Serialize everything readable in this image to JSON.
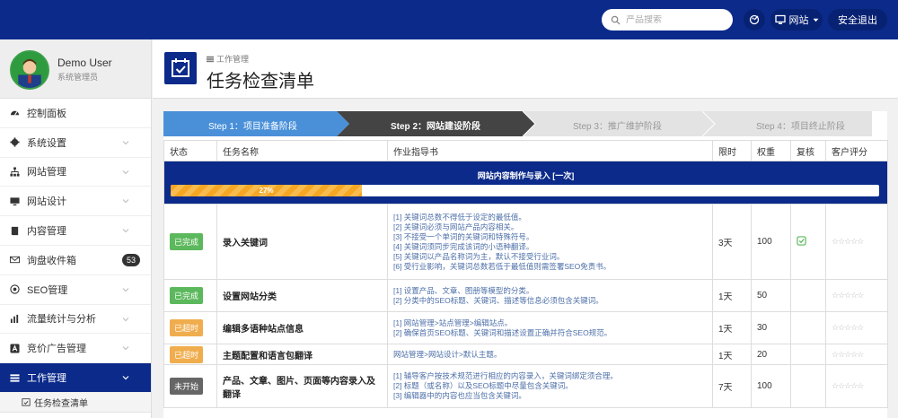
{
  "topbar": {
    "search_placeholder": "产品搜索",
    "website_label": "网站",
    "logout_label": "安全退出"
  },
  "user": {
    "name": "Demo User",
    "role": "系统管理员"
  },
  "sidebar": {
    "items": [
      {
        "label": "控制面板",
        "icon": "dashboard-icon"
      },
      {
        "label": "系统设置",
        "icon": "gear-icon"
      },
      {
        "label": "网站管理",
        "icon": "sitemap-icon"
      },
      {
        "label": "网站设计",
        "icon": "monitor-icon"
      },
      {
        "label": "内容管理",
        "icon": "book-icon"
      },
      {
        "label": "询盘收件箱",
        "icon": "envelope-icon",
        "badge": "53"
      },
      {
        "label": "SEO管理",
        "icon": "target-icon"
      },
      {
        "label": "流量统计与分析",
        "icon": "bar-chart-icon"
      },
      {
        "label": "竞价广告管理",
        "icon": "ad-icon"
      },
      {
        "label": "工作管理",
        "icon": "list-icon"
      }
    ],
    "submenu_label": "任务检查清单"
  },
  "header": {
    "breadcrumb": "工作管理",
    "title": "任务检查清单"
  },
  "steps": [
    {
      "label": "Step 1：项目准备阶段"
    },
    {
      "label": "Step 2：网站建设阶段"
    },
    {
      "label": "Step 3：推广维护阶段"
    },
    {
      "label": "Step 4：项目终止阶段"
    }
  ],
  "table": {
    "headers": [
      "状态",
      "任务名称",
      "作业指导书",
      "限时",
      "权重",
      "复核",
      "客户评分"
    ],
    "section_title": "网站内容制作与录入 [一次]",
    "progress": 27,
    "progress_label": "27%",
    "rows": [
      {
        "status": "已完成",
        "status_type": "done",
        "name": "录入关键词",
        "guide": [
          "[1] 关键词总数不得低于设定的最低值。",
          "[2] 关键词必须与网站产品内容相关。",
          "[3] 不接受一个单词的关键词和特殊符号。",
          "[4] 关键词须同步完成该词的小语种翻译。",
          "[5] 关键词以产品名称词为主，默认不接受行业词。",
          "[6] 受行业影响，关键词总数若低于最低值则需签署SEO免责书。"
        ],
        "time": "3天",
        "weight": "100",
        "checked": true,
        "rating": "☆☆☆☆☆"
      },
      {
        "status": "已完成",
        "status_type": "done",
        "name": "设置网站分类",
        "guide": [
          "[1] 设置产品、文章、图册等模型的分类。",
          "[2] 分类中的SEO标题、关键词、描述等信息必须包含关键词。"
        ],
        "time": "1天",
        "weight": "50",
        "checked": false,
        "rating": "☆☆☆☆☆"
      },
      {
        "status": "已超时",
        "status_type": "late",
        "name": "编辑多语种站点信息",
        "guide": [
          "[1] 网站管理>站点管理>编辑站点。",
          "[2] 确保首页SEO标题、关键词和描述设置正确并符合SEO规范。"
        ],
        "time": "1天",
        "weight": "30",
        "checked": false,
        "rating": "☆☆☆☆☆"
      },
      {
        "status": "已超时",
        "status_type": "late",
        "name": "主题配置和语言包翻译",
        "guide": [
          "网站管理>网站设计>默认主题。"
        ],
        "time": "1天",
        "weight": "20",
        "checked": false,
        "rating": "☆☆☆☆☆"
      },
      {
        "status": "未开始",
        "status_type": "todo",
        "name": "产品、文章、图片、页面等内容录入及翻译",
        "guide": [
          "[1] 辅导客户按技术规范进行相应的内容录入，关键词绑定须合理。",
          "[2] 标题（或名称）以及SEO标题中尽量包含关键词。",
          "[3] 编辑器中的内容也应当包含关键词。"
        ],
        "time": "7天",
        "weight": "100",
        "checked": false,
        "rating": "☆☆☆☆☆"
      }
    ]
  },
  "colors": {
    "primary": "#0b2a8a",
    "done": "#5cb85c",
    "late": "#f0ad4e",
    "todo": "#666666",
    "progress": "#f5a623"
  }
}
